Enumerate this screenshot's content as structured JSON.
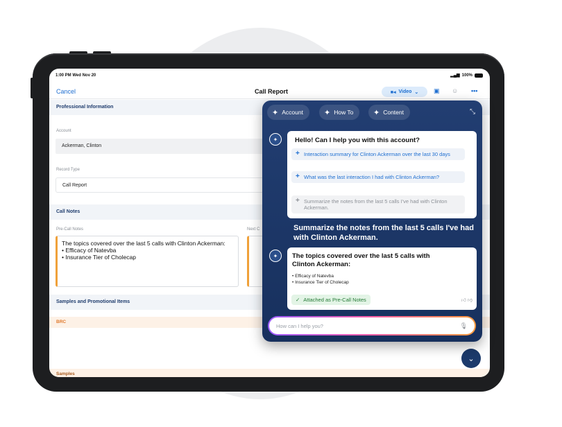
{
  "status": {
    "time": "1:00 PM  Wed Nov 20",
    "signal": "100%"
  },
  "nav": {
    "cancel": "Cancel",
    "title": "Call Report",
    "video": "Video"
  },
  "form": {
    "section_professional": "Professional Information",
    "account_label": "Account",
    "account_value": "Ackerman, Clinton",
    "record_type_label": "Record Type",
    "record_type_value": "Call Report",
    "section_call_notes": "Call Notes",
    "pre_call_label": "Pre-Call Notes",
    "next_call_label": "Next C",
    "notes_line1": "The topics covered over the last 5 calls with Clinton Ackerman:",
    "notes_line2": "• Efficacy of Natevba",
    "notes_line3": "• Insurance Tier of Cholecap",
    "section_samples": "Samples and Promotional Items",
    "brc_label": "BRC",
    "samples_label": "Samples"
  },
  "assistant": {
    "chips": [
      "Account",
      "How To",
      "Content"
    ],
    "greeting": "Hello! Can I help you with this account?",
    "suggestions": [
      "Interaction summary for Clinton Ackerman over the last 30 days",
      "What was the last interaction I had with Clinton Ackerman?",
      "Summarize the notes from the last 5 calls I've had with Clinton Ackerman."
    ],
    "user_message": "Summarize the notes from the last 5 calls I've had with Clinton Ackerman.",
    "response_title": "The topics covered over the last 5 calls with Clinton Ackerman:",
    "response_bullets": [
      "• Efficacy of Natevba",
      "• Insurance Tier of Cholecap"
    ],
    "attached_label": "Attached as Pre-Call Notes",
    "input_placeholder": "How can I help you?"
  },
  "colors": {
    "accent": "#1f6fd1",
    "panel": "#1c3a6b",
    "notes_border": "#f0a13a"
  },
  "icons": [
    "sparkle-icon",
    "expand-icon",
    "assistant-icon",
    "mic-icon",
    "check-icon",
    "thumbs-up-icon",
    "thumbs-down-icon",
    "chevron-down-icon",
    "video-icon",
    "calendar-icon",
    "contacts-icon",
    "more-icon"
  ]
}
